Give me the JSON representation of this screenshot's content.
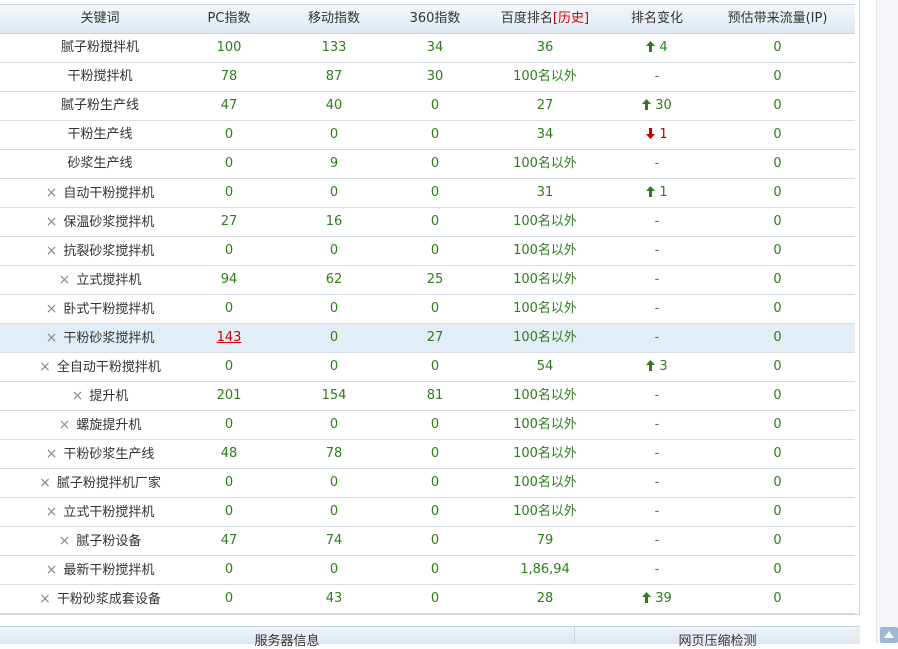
{
  "header": {
    "keyword": "关键词",
    "pc_index": "PC指数",
    "mobile_index": "移动指数",
    "index_360": "360指数",
    "baidu_rank": "百度排名",
    "history_link": "[历史]",
    "rank_change": "排名变化",
    "est_traffic": "预估带来流量(IP)"
  },
  "rows": [
    {
      "kw": "腻子粉搅拌机",
      "x": false,
      "pc": "100",
      "mob": "133",
      "i360": "34",
      "rank": "36",
      "chg": "4",
      "dir": "up",
      "flow": "0"
    },
    {
      "kw": "干粉搅拌机",
      "x": false,
      "pc": "78",
      "mob": "87",
      "i360": "30",
      "rank": "100名以外",
      "chg": "-",
      "dir": "none",
      "flow": "0"
    },
    {
      "kw": "腻子粉生产线",
      "x": false,
      "pc": "47",
      "mob": "40",
      "i360": "0",
      "rank": "27",
      "chg": "30",
      "dir": "up",
      "flow": "0"
    },
    {
      "kw": "干粉生产线",
      "x": false,
      "pc": "0",
      "mob": "0",
      "i360": "0",
      "rank": "34",
      "chg": "1",
      "dir": "down",
      "flow": "0"
    },
    {
      "kw": "砂浆生产线",
      "x": false,
      "pc": "0",
      "mob": "9",
      "i360": "0",
      "rank": "100名以外",
      "chg": "-",
      "dir": "none",
      "flow": "0"
    },
    {
      "kw": "自动干粉搅拌机",
      "x": true,
      "pc": "0",
      "mob": "0",
      "i360": "0",
      "rank": "31",
      "chg": "1",
      "dir": "up",
      "flow": "0"
    },
    {
      "kw": "保温砂浆搅拌机",
      "x": true,
      "pc": "27",
      "mob": "16",
      "i360": "0",
      "rank": "100名以外",
      "chg": "-",
      "dir": "none",
      "flow": "0"
    },
    {
      "kw": "抗裂砂浆搅拌机",
      "x": true,
      "pc": "0",
      "mob": "0",
      "i360": "0",
      "rank": "100名以外",
      "chg": "-",
      "dir": "none",
      "flow": "0"
    },
    {
      "kw": "立式搅拌机",
      "x": true,
      "pc": "94",
      "mob": "62",
      "i360": "25",
      "rank": "100名以外",
      "chg": "-",
      "dir": "none",
      "flow": "0"
    },
    {
      "kw": "卧式干粉搅拌机",
      "x": true,
      "pc": "0",
      "mob": "0",
      "i360": "0",
      "rank": "100名以外",
      "chg": "-",
      "dir": "none",
      "flow": "0"
    },
    {
      "kw": "干粉砂浆搅拌机",
      "x": true,
      "pc": "143",
      "mob": "0",
      "i360": "27",
      "rank": "100名以外",
      "chg": "-",
      "dir": "none",
      "flow": "0",
      "highlight": true,
      "pc_link": true
    },
    {
      "kw": "全自动干粉搅拌机",
      "x": true,
      "pc": "0",
      "mob": "0",
      "i360": "0",
      "rank": "54",
      "chg": "3",
      "dir": "up",
      "flow": "0"
    },
    {
      "kw": "提升机",
      "x": true,
      "pc": "201",
      "mob": "154",
      "i360": "81",
      "rank": "100名以外",
      "chg": "-",
      "dir": "none",
      "flow": "0"
    },
    {
      "kw": "螺旋提升机",
      "x": true,
      "pc": "0",
      "mob": "0",
      "i360": "0",
      "rank": "100名以外",
      "chg": "-",
      "dir": "none",
      "flow": "0"
    },
    {
      "kw": "干粉砂浆生产线",
      "x": true,
      "pc": "48",
      "mob": "78",
      "i360": "0",
      "rank": "100名以外",
      "chg": "-",
      "dir": "none",
      "flow": "0"
    },
    {
      "kw": "腻子粉搅拌机厂家",
      "x": true,
      "pc": "0",
      "mob": "0",
      "i360": "0",
      "rank": "100名以外",
      "chg": "-",
      "dir": "none",
      "flow": "0"
    },
    {
      "kw": "立式干粉搅拌机",
      "x": true,
      "pc": "0",
      "mob": "0",
      "i360": "0",
      "rank": "100名以外",
      "chg": "-",
      "dir": "none",
      "flow": "0"
    },
    {
      "kw": "腻子粉设备",
      "x": true,
      "pc": "47",
      "mob": "74",
      "i360": "0",
      "rank": "79",
      "chg": "-",
      "dir": "none",
      "flow": "0"
    },
    {
      "kw": "最新干粉搅拌机",
      "x": true,
      "pc": "0",
      "mob": "0",
      "i360": "0",
      "rank": "1,86,94",
      "chg": "-",
      "dir": "none",
      "flow": "0"
    },
    {
      "kw": "干粉砂浆成套设备",
      "x": true,
      "pc": "0",
      "mob": "43",
      "i360": "0",
      "rank": "28",
      "chg": "39",
      "dir": "up",
      "flow": "0"
    }
  ],
  "footer": {
    "server_info": "服务器信息",
    "compression_check": "网页压缩检测"
  },
  "icons": {
    "remove": "×",
    "up_color": "#2e7d1a",
    "down_color": "#c00000"
  }
}
